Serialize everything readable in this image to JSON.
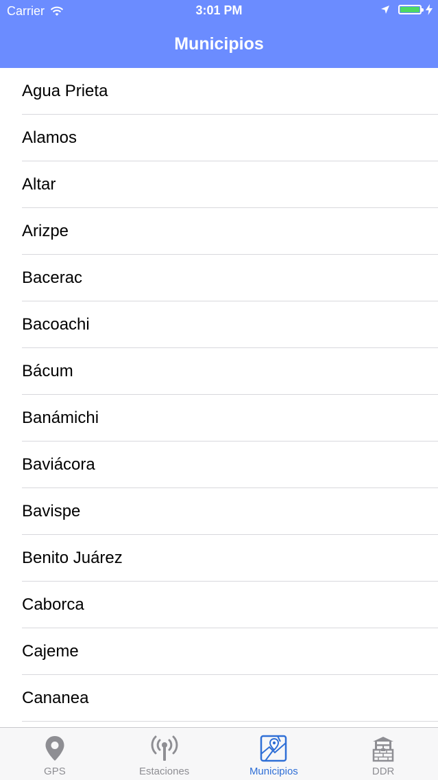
{
  "status_bar": {
    "carrier": "Carrier",
    "time": "3:01 PM"
  },
  "nav": {
    "title": "Municipios"
  },
  "colors": {
    "header": "#6b8cff",
    "active_tab": "#2f6fd6",
    "inactive_tab": "#8e8e93",
    "battery": "#4cd964"
  },
  "list": {
    "items": [
      "Agua Prieta",
      "Alamos",
      "Altar",
      "Arizpe",
      "Bacerac",
      "Bacoachi",
      "Bácum",
      "Banámichi",
      "Baviácora",
      "Bavispe",
      "Benito Juárez",
      "Caborca",
      "Cajeme",
      "Cananea"
    ]
  },
  "tabbar": {
    "tabs": [
      {
        "label": "GPS",
        "icon": "map-pin-icon",
        "active": false
      },
      {
        "label": "Estaciones",
        "icon": "antenna-icon",
        "active": false
      },
      {
        "label": "Municipios",
        "icon": "map-icon",
        "active": true
      },
      {
        "label": "DDR",
        "icon": "well-icon",
        "active": false
      }
    ]
  }
}
